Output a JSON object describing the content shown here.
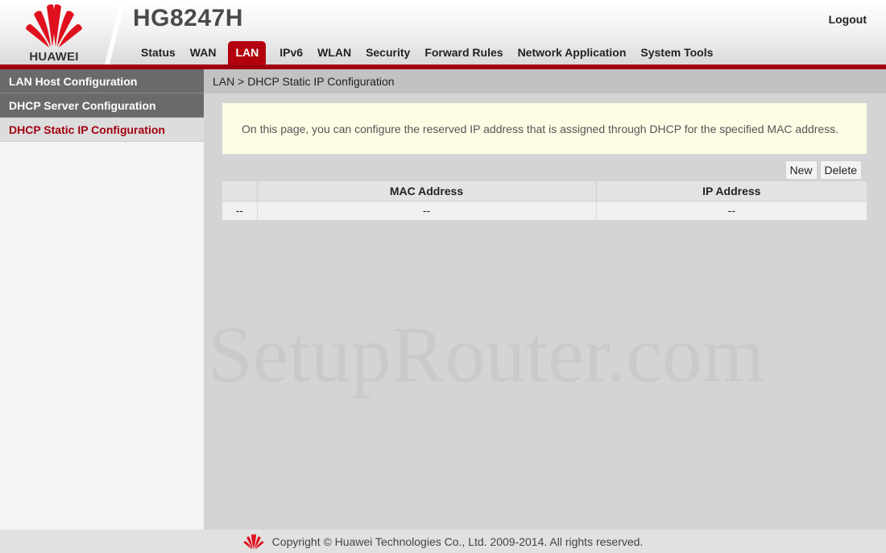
{
  "header": {
    "brand": "HUAWEI",
    "model": "HG8247H",
    "logout_label": "Logout",
    "accent_color": "#b3000f"
  },
  "nav": {
    "items": [
      {
        "label": "Status",
        "active": false
      },
      {
        "label": "WAN",
        "active": false
      },
      {
        "label": "LAN",
        "active": true
      },
      {
        "label": "IPv6",
        "active": false
      },
      {
        "label": "WLAN",
        "active": false
      },
      {
        "label": "Security",
        "active": false
      },
      {
        "label": "Forward Rules",
        "active": false
      },
      {
        "label": "Network Application",
        "active": false
      },
      {
        "label": "System Tools",
        "active": false
      }
    ]
  },
  "sidebar": {
    "items": [
      {
        "label": "LAN Host Configuration",
        "active": false
      },
      {
        "label": "DHCP Server Configuration",
        "active": false
      },
      {
        "label": "DHCP Static IP Configuration",
        "active": true
      }
    ]
  },
  "main": {
    "breadcrumb": "LAN > DHCP Static IP Configuration",
    "notice": "On this page, you can configure the reserved IP address that is assigned through DHCP for the specified MAC address.",
    "buttons": {
      "new_label": "New",
      "delete_label": "Delete"
    },
    "table": {
      "columns": [
        "",
        "MAC Address",
        "IP Address"
      ],
      "rows": [
        [
          "--",
          "--",
          "--"
        ]
      ]
    },
    "watermark": "SetupRouter.com"
  },
  "footer": {
    "copyright": "Copyright © Huawei Technologies Co., Ltd. 2009-2014. All rights reserved."
  }
}
